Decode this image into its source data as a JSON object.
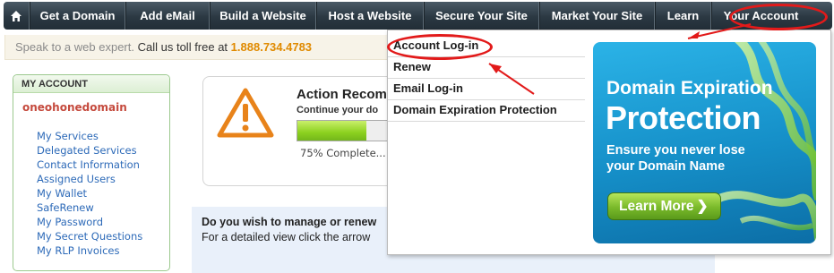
{
  "navbar": {
    "items": [
      {
        "label": "Get a Domain"
      },
      {
        "label": "Add eMail"
      },
      {
        "label": "Build a Website"
      },
      {
        "label": "Host a Website"
      },
      {
        "label": "Secure Your Site"
      },
      {
        "label": "Market Your Site"
      },
      {
        "label": "Learn"
      },
      {
        "label": "Your Account"
      }
    ]
  },
  "speak_bar": {
    "text": "Speak to a web expert.",
    "call_text": "Call us toll free at",
    "phone": "1.888.734.4783"
  },
  "account_panel": {
    "header": "MY ACCOUNT",
    "username": "oneohonedomain",
    "links": [
      "My Services",
      "Delegated Services",
      "Contact Information",
      "Assigned Users",
      "My Wallet",
      "SafeRenew",
      "My Password",
      "My Secret Questions",
      "My RLP Invoices"
    ]
  },
  "action_card": {
    "title": "Action Recomm",
    "subtitle": "Continue your do",
    "progress_fraction": 0.75,
    "progress_text": "75% Complete..."
  },
  "manage": {
    "question": "Do you wish to manage or renew",
    "detail": "For a detailed view click the arrow"
  },
  "dropdown": {
    "items": [
      {
        "label": "Account Log-in"
      },
      {
        "label": "Renew"
      },
      {
        "label": "Email Log-in"
      },
      {
        "label": "Domain Expiration Protection"
      }
    ]
  },
  "promo": {
    "line1": "Domain Expiration",
    "line2": "Protection",
    "sub1": "Ensure you never lose",
    "sub2": "your Domain Name",
    "button": "Learn More"
  },
  "colors": {
    "annotation": "#e21a1a",
    "link": "#2d6ab8",
    "phone": "#e08a00",
    "username": "#c54a3d"
  }
}
